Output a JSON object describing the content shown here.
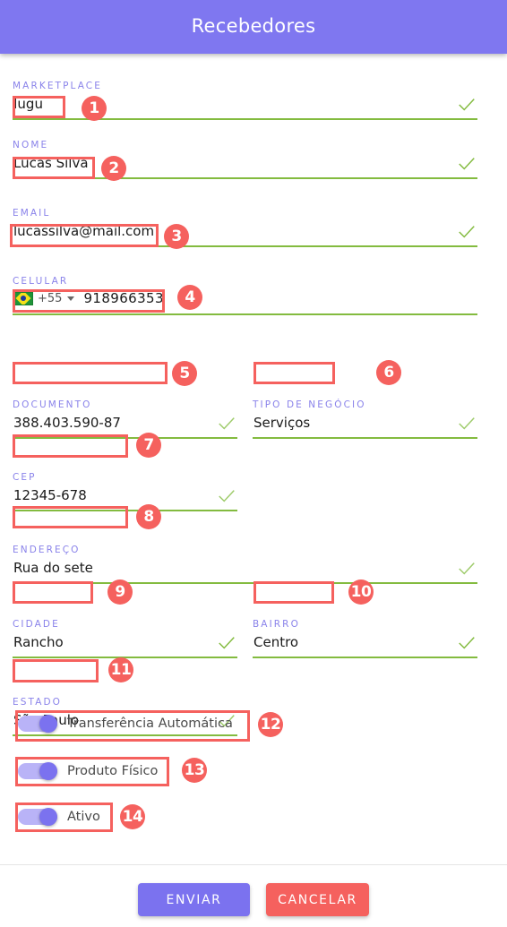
{
  "header": {
    "title": "Recebedores",
    "bg_color": "#7f77f0"
  },
  "colors": {
    "accent_purple": "#7b72ef",
    "label_purple": "#8a83ea",
    "valid_green": "#83bb3f",
    "annotation_red": "#f5615e",
    "cancel_red": "#f5615e"
  },
  "fields": [
    {
      "key": "marketplace",
      "label": "MARKETPLACE",
      "value": "Iugu",
      "valid": true
    },
    {
      "key": "nome",
      "label": "NOME",
      "value": "Lucas Silva",
      "valid": true
    },
    {
      "key": "email",
      "label": "EMAIL",
      "value": "lucassilva@mail.com",
      "valid": true
    },
    {
      "key": "celular",
      "label": "CELULAR",
      "value": "918966353",
      "country_code": "+55",
      "flag": "brazil-flag-icon",
      "valid": false
    },
    {
      "key": "documento",
      "label": "DOCUMENTO",
      "value": "388.403.590-87",
      "valid": true
    },
    {
      "key": "tipo_negocio",
      "label": "TIPO DE NEGÓCIO",
      "value": "Serviços",
      "valid": true
    },
    {
      "key": "cep",
      "label": "CEP",
      "value": "12345-678",
      "valid": true
    },
    {
      "key": "endereco",
      "label": "ENDEREÇO",
      "value": "Rua do sete",
      "valid": true
    },
    {
      "key": "cidade",
      "label": "CIDADE",
      "value": "Rancho",
      "valid": true
    },
    {
      "key": "bairro",
      "label": "BAIRRO",
      "value": "Centro",
      "valid": true
    },
    {
      "key": "estado",
      "label": "ESTADO",
      "value": "São Paulo",
      "valid": true
    }
  ],
  "toggles": [
    {
      "key": "transferencia_automatica",
      "label": "Transferência Automática",
      "on": true
    },
    {
      "key": "produto_fisico",
      "label": "Produto Físico",
      "on": true
    },
    {
      "key": "ativo",
      "label": "Ativo",
      "on": true
    }
  ],
  "footer": {
    "submit_label": "ENVIAR",
    "cancel_label": "CANCELAR"
  },
  "annotations": [
    {
      "n": "1",
      "target": "marketplace"
    },
    {
      "n": "2",
      "target": "nome"
    },
    {
      "n": "3",
      "target": "email"
    },
    {
      "n": "4",
      "target": "celular"
    },
    {
      "n": "5",
      "target": "documento"
    },
    {
      "n": "6",
      "target": "tipo_negocio"
    },
    {
      "n": "7",
      "target": "cep"
    },
    {
      "n": "8",
      "target": "endereco"
    },
    {
      "n": "9",
      "target": "cidade"
    },
    {
      "n": "10",
      "target": "bairro"
    },
    {
      "n": "11",
      "target": "estado"
    },
    {
      "n": "12",
      "target": "transferencia_automatica"
    },
    {
      "n": "13",
      "target": "produto_fisico"
    },
    {
      "n": "14",
      "target": "ativo"
    }
  ]
}
